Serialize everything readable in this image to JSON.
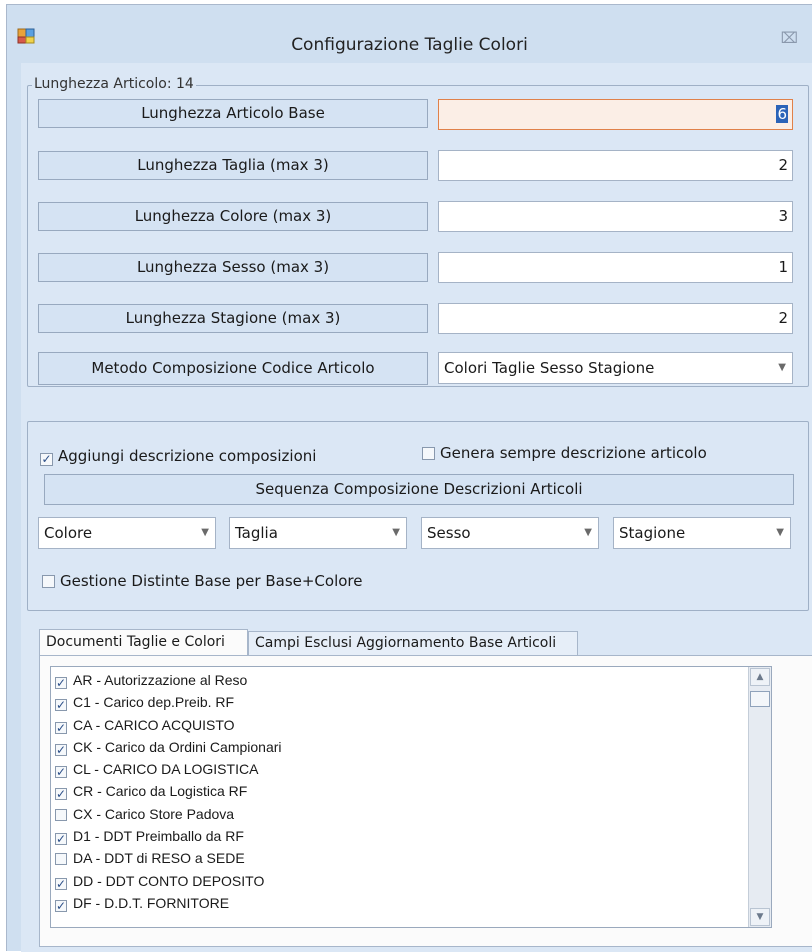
{
  "window": {
    "title": "Configurazione Taglie Colori",
    "close_glyph": "⌧",
    "icon": "app-window-icon"
  },
  "lengths": {
    "legend": "Lunghezza Articolo: 14",
    "rows": [
      {
        "label": "Lunghezza Articolo Base",
        "value": "6"
      },
      {
        "label": "Lunghezza Taglia (max 3)",
        "value": "2"
      },
      {
        "label": "Lunghezza Colore (max 3)",
        "value": "3"
      },
      {
        "label": "Lunghezza Sesso (max 3)",
        "value": "1"
      },
      {
        "label": "Lunghezza Stagione (max 3)",
        "value": "2"
      }
    ],
    "method_label": "Metodo Composizione Codice Articolo",
    "method_value": "Colori Taglie Sesso Stagione"
  },
  "descriptions": {
    "add_composition": {
      "label": "Aggiungi descrizione composizioni",
      "checked": true
    },
    "always_generate": {
      "label": "Genera sempre descrizione articolo",
      "checked": false
    },
    "sequence_label": "Sequenza Composizione Descrizioni Articoli",
    "sequence": [
      "Colore",
      "Taglia",
      "Sesso",
      "Stagione"
    ],
    "bom_option": {
      "label": "Gestione Distinte Base per Base+Colore",
      "checked": false
    }
  },
  "tabs": [
    "Documenti Taglie e Colori",
    "Campi Esclusi Aggiornamento Base Articoli"
  ],
  "documents": [
    {
      "label": "AR - Autorizzazione al Reso",
      "checked": true
    },
    {
      "label": "C1 - Carico dep.Preib. RF",
      "checked": true
    },
    {
      "label": "CA - CARICO ACQUISTO",
      "checked": true
    },
    {
      "label": "CK - Carico da Ordini Campionari",
      "checked": true
    },
    {
      "label": "CL - CARICO DA LOGISTICA",
      "checked": true
    },
    {
      "label": "CR - Carico da Logistica RF",
      "checked": true
    },
    {
      "label": "CX - Carico Store Padova",
      "checked": false
    },
    {
      "label": "D1 - DDT Preimballo da RF",
      "checked": true
    },
    {
      "label": "DA - DDT di RESO a SEDE",
      "checked": false
    },
    {
      "label": "DD - DDT CONTO DEPOSITO",
      "checked": true
    },
    {
      "label": "DF - D.D.T. FORNITORE",
      "checked": true
    }
  ],
  "colors": {
    "focus_border": "#e0814a",
    "selection": "#2b63b8",
    "window_bg": "#dbe7f5"
  }
}
